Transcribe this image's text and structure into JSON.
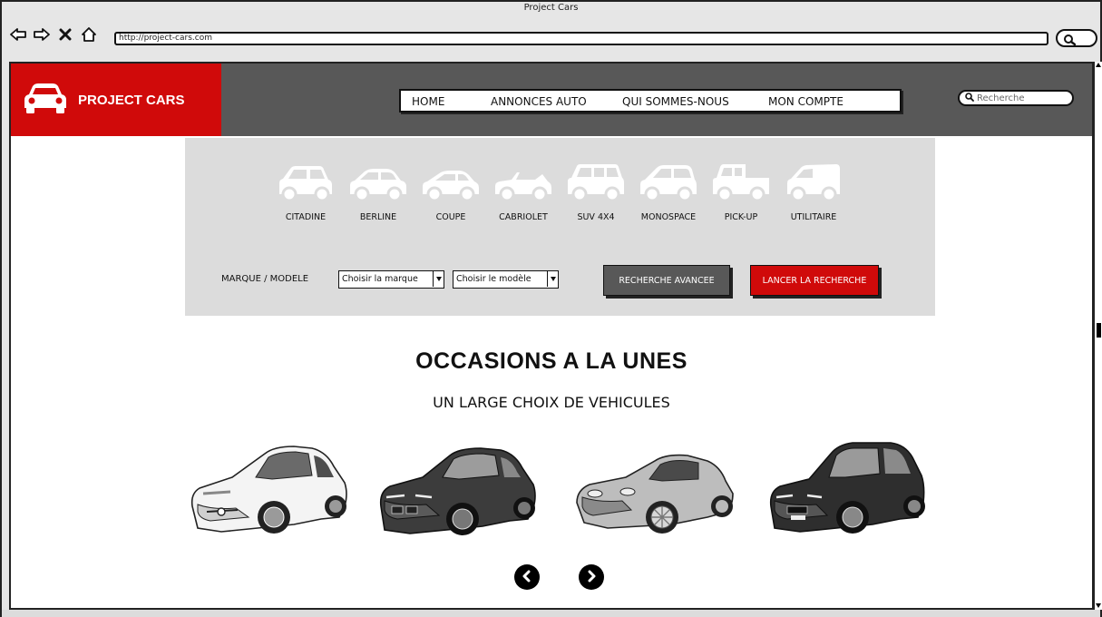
{
  "browser": {
    "title": "Project Cars",
    "url": "http://project-cars.com"
  },
  "header": {
    "brand": "PROJECT CARS",
    "nav": [
      "HOME",
      "ANNONCES AUTO",
      "QUI SOMMES-NOUS",
      "MON COMPTE"
    ],
    "search_placeholder": "Recherche"
  },
  "filter": {
    "categories": [
      "CITADINE",
      "BERLINE",
      "COUPE",
      "CABRIOLET",
      "SUV 4X4",
      "MONOSPACE",
      "PICK-UP",
      "UTILITAIRE"
    ],
    "brand_label": "MARQUE / MODELE",
    "brand_select": "Choisir la marque",
    "model_select": "Choisir le modèle",
    "advanced_button": "RECHERCHE AVANCEE",
    "search_button": "LANCER LA RECHERCHE"
  },
  "featured": {
    "title": "OCCASIONS A LA UNES",
    "subtitle": "UN LARGE CHOIX DE VEHICULES"
  },
  "colors": {
    "brand_red": "#d00a0a",
    "header_gray": "#585858",
    "panel_gray": "#dcdcdc"
  }
}
